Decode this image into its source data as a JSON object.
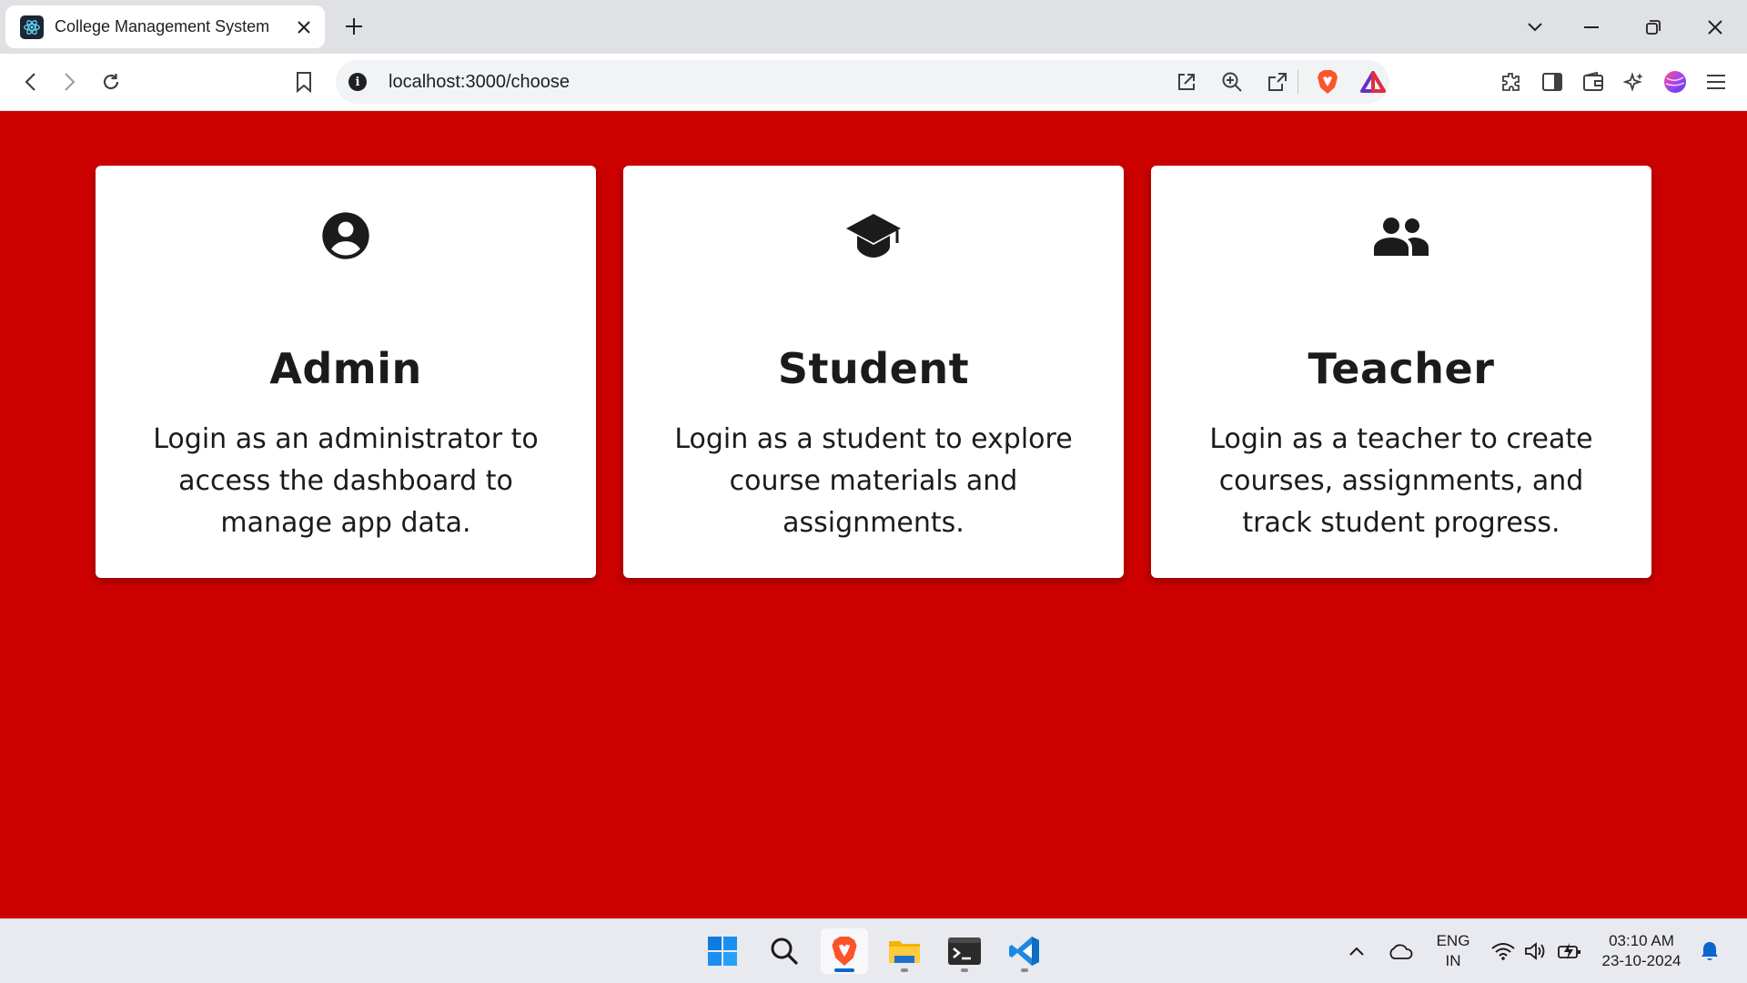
{
  "browser": {
    "tab_title": "College Management System",
    "url": "localhost:3000/choose"
  },
  "cards": [
    {
      "title": "Admin",
      "description": "Login as an administrator to access the dashboard to manage app data.",
      "icon": "account-circle-icon"
    },
    {
      "title": "Student",
      "description": "Login as a student to explore course materials and assignments.",
      "icon": "graduation-cap-icon"
    },
    {
      "title": "Teacher",
      "description": "Login as a teacher to create courses, assignments, and track student progress.",
      "icon": "people-icon"
    }
  ],
  "taskbar": {
    "apps": [
      "start-icon",
      "search-icon",
      "brave-icon",
      "file-explorer-icon",
      "terminal-icon",
      "vscode-icon"
    ],
    "language": {
      "line1": "ENG",
      "line2": "IN"
    },
    "time": "03:10 AM",
    "date": "23-10-2024"
  },
  "colors": {
    "page_background": "#cd0000",
    "card_background": "#ffffff",
    "text": "#1b1b1b"
  }
}
